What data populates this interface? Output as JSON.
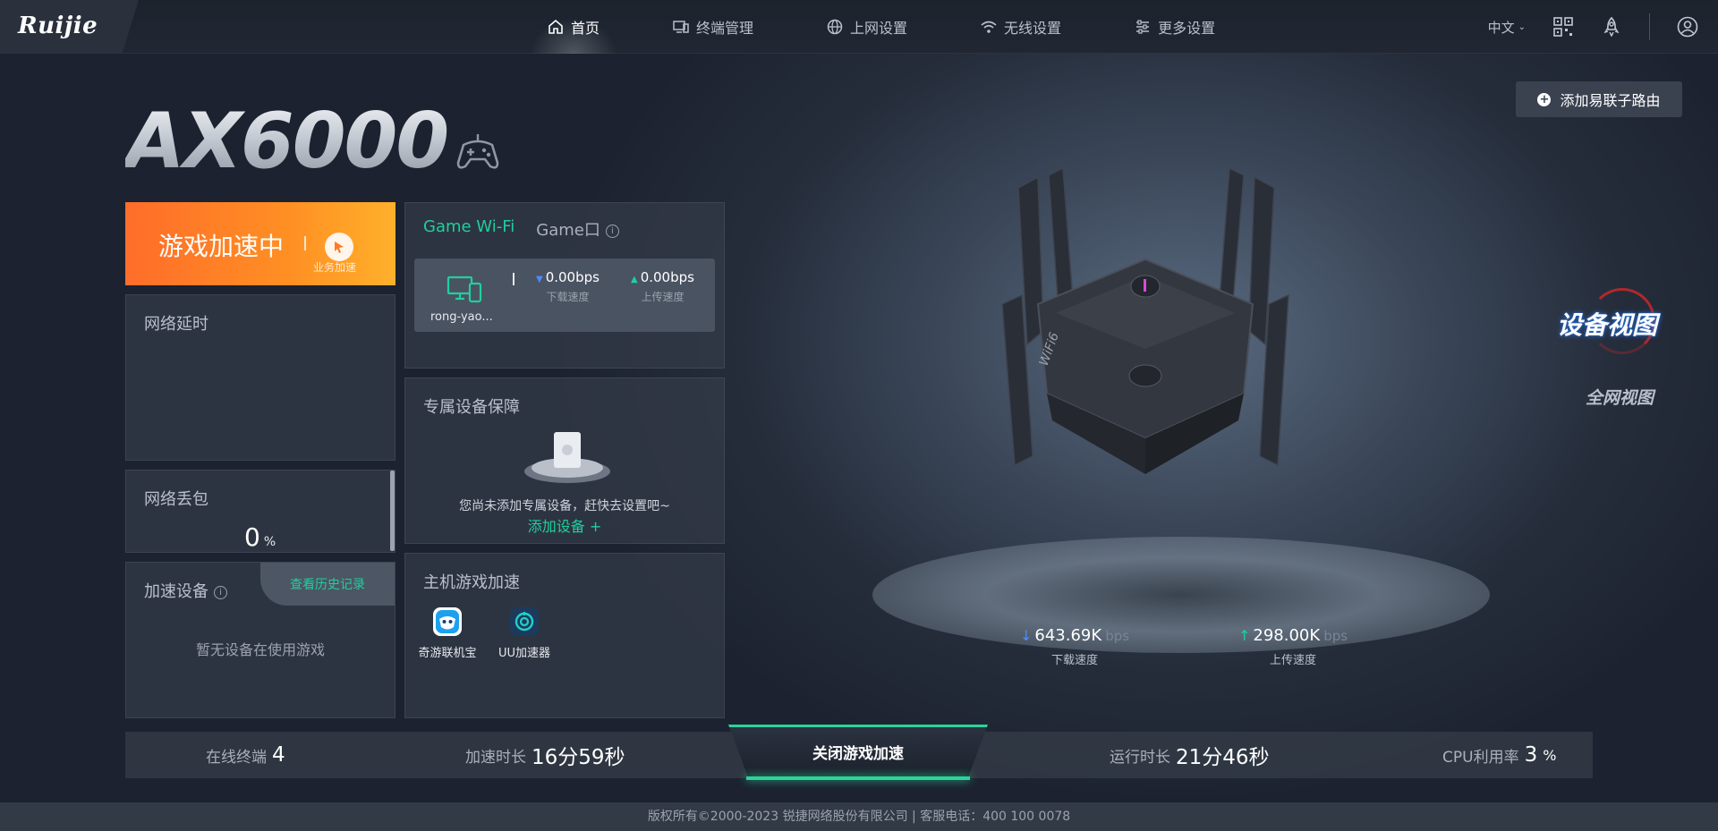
{
  "brand": {
    "logo": "Ruijie"
  },
  "nav": {
    "items": [
      {
        "label": "首页",
        "icon": "home-icon"
      },
      {
        "label": "终端管理",
        "icon": "devices-icon"
      },
      {
        "label": "上网设置",
        "icon": "globe-icon"
      },
      {
        "label": "无线设置",
        "icon": "wifi-icon"
      },
      {
        "label": "更多设置",
        "icon": "sliders-icon"
      }
    ],
    "active_index": 0
  },
  "topbar": {
    "language": "中文",
    "icons": [
      "qr-code-icon",
      "rocket-icon",
      "user-icon"
    ]
  },
  "model": {
    "name": "AX6000",
    "icon": "gamepad-icon"
  },
  "boost": {
    "status": "游戏加速中",
    "sub_label": "业务加速"
  },
  "latency": {
    "title": "网络延时"
  },
  "packet_loss": {
    "title": "网络丢包",
    "value": "0",
    "unit": "%"
  },
  "accelerated_devices": {
    "title": "加速设备",
    "history_button": "查看历史记录",
    "empty": "暂无设备在使用游戏"
  },
  "game_ports": {
    "tabs": [
      "Game Wi-Fi",
      "Game口"
    ],
    "active_tab": 0,
    "device": {
      "name": "rong-yao...",
      "download": "0.00bps",
      "download_label": "下载速度",
      "upload": "0.00bps",
      "upload_label": "上传速度"
    }
  },
  "dedicated": {
    "title": "专属设备保障",
    "message": "您尚未添加专属设备，赶快去设置吧~",
    "add_label": "添加设备 +"
  },
  "console": {
    "title": "主机游戏加速",
    "apps": [
      {
        "label": "奇游联机宝",
        "icon": "qiyou-icon",
        "color": "#ffffff"
      },
      {
        "label": "UU加速器",
        "icon": "uu-icon",
        "color": "#1d3a5c"
      }
    ]
  },
  "router": {
    "add_mesh": "添加易联子路由",
    "download": {
      "value": "643.69K",
      "unit": "bps",
      "label": "下载速度"
    },
    "upload": {
      "value": "298.00K",
      "unit": "bps",
      "label": "上传速度"
    },
    "views": {
      "device": "设备视图",
      "network": "全网视图"
    }
  },
  "bottom": {
    "online_label": "在线终端",
    "online_value": "4",
    "boost_time_label": "加速时长",
    "boost_time_value": "16分59秒",
    "close_button": "关闭游戏加速",
    "uptime_label": "运行时长",
    "uptime_value": "21分46秒",
    "cpu_label": "CPU利用率",
    "cpu_value": "3",
    "cpu_unit": "%"
  },
  "footer": {
    "text": "版权所有©2000-2023 锐捷网络股份有限公司 | 客服电话：400 100 0078"
  },
  "colors": {
    "accent": "#1fcf9e",
    "boost_orange": "#ff7a25",
    "background": "#252d3b"
  }
}
